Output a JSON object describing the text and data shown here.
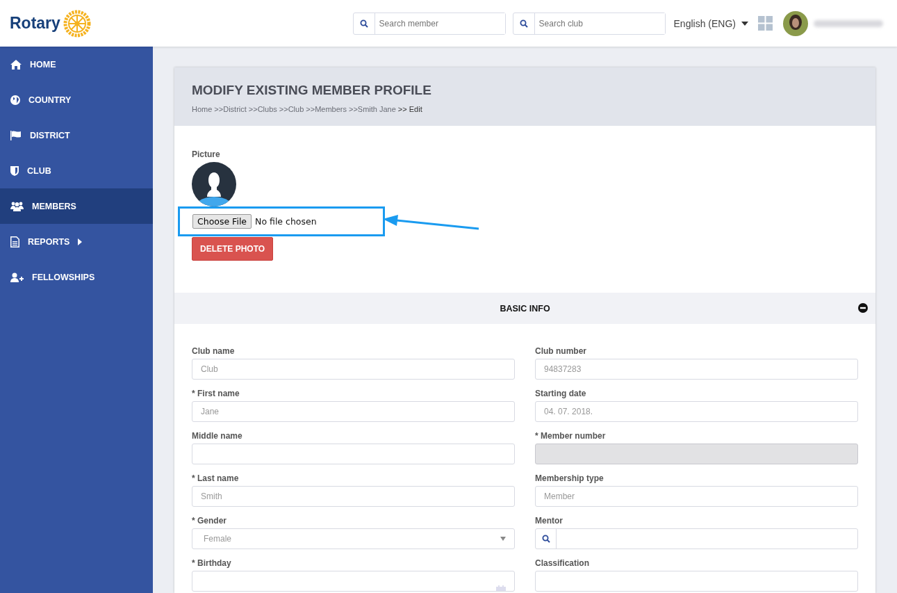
{
  "header": {
    "logo_text": "Rotary",
    "search_member": {
      "placeholder": "Search member"
    },
    "search_club": {
      "placeholder": "Search club"
    },
    "language": "English (ENG)"
  },
  "sidebar": {
    "items": [
      {
        "label": "HOME",
        "selected": false,
        "has_submenu": false
      },
      {
        "label": "COUNTRY",
        "selected": false,
        "has_submenu": false
      },
      {
        "label": "DISTRICT",
        "selected": false,
        "has_submenu": false
      },
      {
        "label": "CLUB",
        "selected": false,
        "has_submenu": false
      },
      {
        "label": "MEMBERS",
        "selected": true,
        "has_submenu": false
      },
      {
        "label": "REPORTS",
        "selected": false,
        "has_submenu": true
      },
      {
        "label": "FELLOWSHIPS",
        "selected": false,
        "has_submenu": false
      }
    ]
  },
  "page": {
    "title": "MODIFY EXISTING MEMBER PROFILE",
    "breadcrumb": [
      "Home",
      ">>District",
      ">>Clubs",
      ">>Club",
      ">>Members",
      ">>Smith Jane",
      ">> Edit"
    ]
  },
  "picture": {
    "label": "Picture",
    "choose_file": "Choose File",
    "file_status": "No file chosen",
    "delete_button": "DELETE PHOTO",
    "highlight": true
  },
  "section": {
    "title": "BASIC INFO",
    "expanded": true
  },
  "fields": [
    {
      "label": "Club name",
      "kind": "text",
      "value": "Club",
      "disabled": false
    },
    {
      "label": "Club number",
      "kind": "text",
      "value": "94837283",
      "disabled": false
    },
    {
      "label": "* First name",
      "kind": "text",
      "value": "Jane",
      "disabled": false
    },
    {
      "label": "Starting date",
      "kind": "text",
      "value": "04. 07. 2018.",
      "disabled": false
    },
    {
      "label": "Middle name",
      "kind": "text",
      "disabled": false
    },
    {
      "label": "* Member number",
      "kind": "text",
      "disabled": true
    },
    {
      "label": "* Last name",
      "kind": "text",
      "value": "Smith",
      "disabled": false
    },
    {
      "label": "Membership type",
      "kind": "text",
      "value": "Member",
      "disabled": false
    },
    {
      "label": "* Gender",
      "kind": "select",
      "value": "Female"
    },
    {
      "label": "Mentor",
      "kind": "search"
    },
    {
      "label": "* Birthday",
      "kind": "date"
    },
    {
      "label": "Classification",
      "kind": "text",
      "disabled": false
    }
  ]
}
